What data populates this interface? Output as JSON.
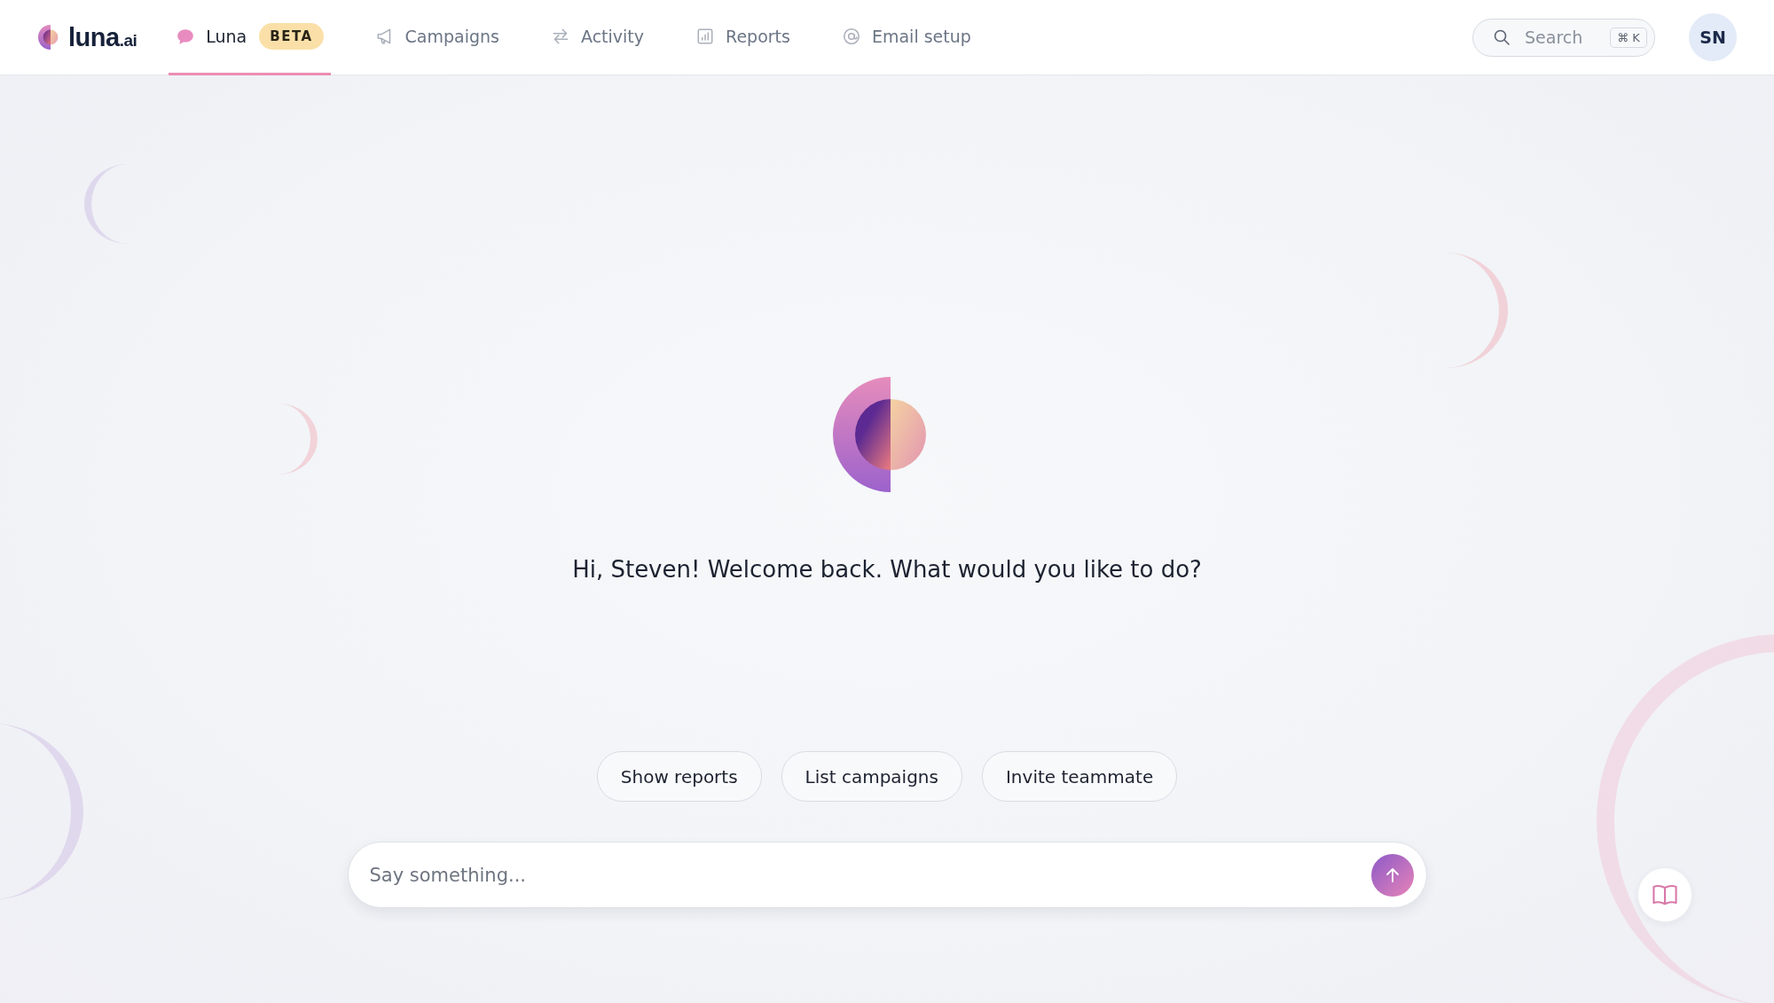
{
  "brand": {
    "name": "luna",
    "suffix": ".ai"
  },
  "nav_tabs": [
    {
      "label": "Luna",
      "badge": "BETA",
      "selected": true
    },
    {
      "label": "Campaigns",
      "selected": false
    },
    {
      "label": "Activity",
      "selected": false
    },
    {
      "label": "Reports",
      "selected": false
    },
    {
      "label": "Email setup",
      "selected": false
    }
  ],
  "search": {
    "placeholder": "Search",
    "shortcut": "⌘ K"
  },
  "avatar": {
    "initials": "SN"
  },
  "greeting": "Hi, Steven! Welcome back. What would you like to do?",
  "suggestions": [
    "Show reports",
    "List campaigns",
    "Invite teammate"
  ],
  "composer": {
    "placeholder": "Say something..."
  }
}
